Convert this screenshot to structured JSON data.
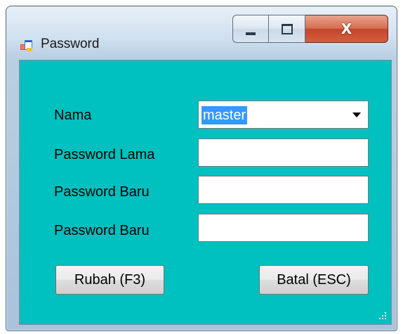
{
  "window": {
    "title": "Password",
    "icon": "form-app-icon",
    "controls": {
      "minimize": "minimize-icon",
      "maximize": "maximize-icon",
      "close": "X"
    }
  },
  "form": {
    "background_color": "#00c0c0",
    "nama": {
      "label": "Nama",
      "value": "master"
    },
    "password_lama": {
      "label": "Password Lama",
      "value": ""
    },
    "password_baru": {
      "label": "Password Baru",
      "value": ""
    },
    "password_baru_confirm": {
      "label": "Password Baru",
      "value": ""
    }
  },
  "buttons": {
    "rubah": "Rubah (F3)",
    "batal": "Batal (ESC)"
  }
}
